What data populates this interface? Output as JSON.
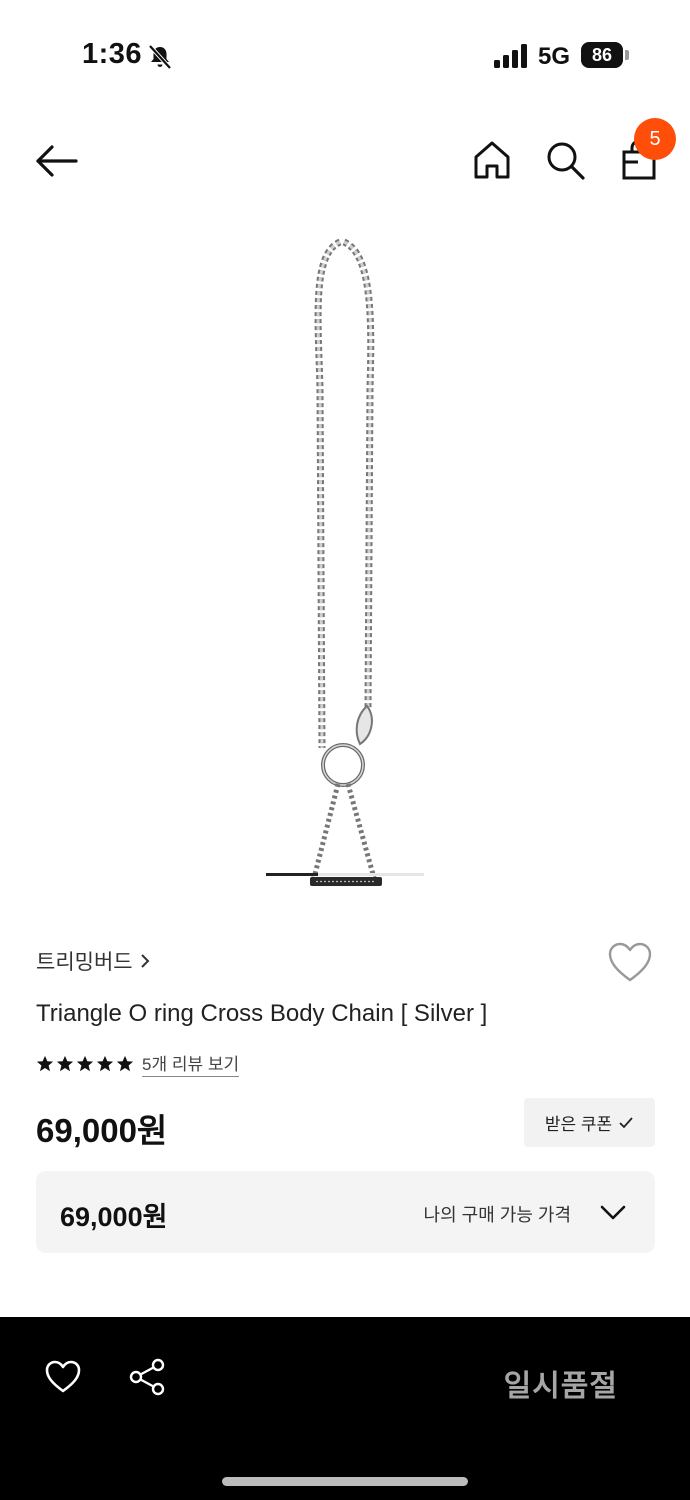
{
  "status_bar": {
    "time": "1:36",
    "network": "5G",
    "battery": "86"
  },
  "nav": {
    "cart_count": "5"
  },
  "carousel": {
    "progress": 0.33
  },
  "product": {
    "brand": "트리밍버드",
    "title": "Triangle O ring Cross Body Chain [ Silver ]",
    "rating_stars": 5,
    "review_link": "5개 리뷰 보기",
    "price": "69,000원",
    "coupon_label": "받은 쿠폰"
  },
  "my_price": {
    "value": "69,000원",
    "label": "나의 구매 가능 가격"
  },
  "bottom_bar": {
    "status": "일시품절"
  },
  "icons": {
    "back": "arrow-left-icon",
    "home": "home-icon",
    "search": "search-icon",
    "cart": "shopping-bag-icon",
    "wish": "heart-icon",
    "share": "share-icon"
  },
  "colors": {
    "badge": "#ff4d0a",
    "bottom_bar": "#000000",
    "soldout_text": "#a6a6a6"
  }
}
